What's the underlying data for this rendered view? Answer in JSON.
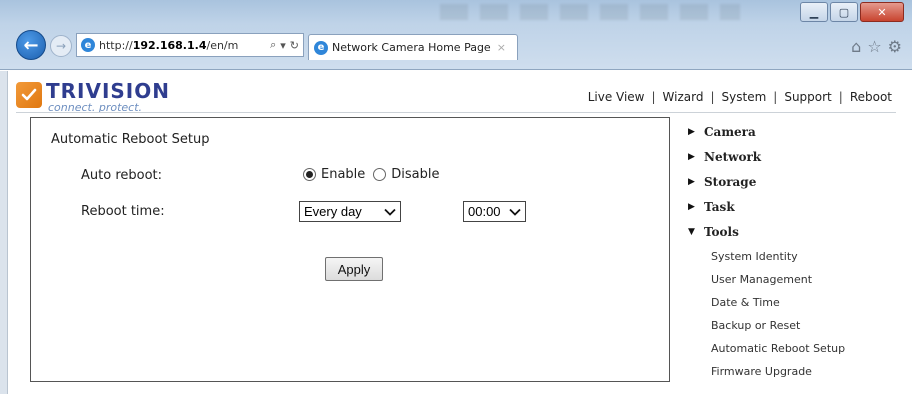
{
  "browser": {
    "url_prefix": "http://",
    "url_host": "192.168.1.4",
    "url_path": "/en/m",
    "tab_title": "Network Camera Home Page",
    "tab_close": "×",
    "back_glyph": "←",
    "forward_glyph": "→",
    "min_glyph": "▁",
    "max_glyph": "▢",
    "close_glyph": "✕",
    "search_glyph": "⌕",
    "dropdown_glyph": "▾",
    "refresh_glyph": "↻",
    "home_glyph": "⌂",
    "favorites_glyph": "☆",
    "settings_glyph": "⚙"
  },
  "brand": {
    "name": "TRIVISION",
    "tagline": "connect. protect.",
    "primary_color": "#2f3d8f",
    "accent_color": "#f29a3a"
  },
  "topnav": {
    "items": [
      "Live View",
      "Wizard",
      "System",
      "Support",
      "Reboot"
    ],
    "separator": "|"
  },
  "panel": {
    "title": "Automatic Reboot Setup",
    "auto_reboot_label": "Auto reboot:",
    "enable_label": "Enable",
    "disable_label": "Disable",
    "selected": "Enable",
    "reboot_time_label": "Reboot time:",
    "frequency_value": "Every day",
    "time_value": "00:00",
    "apply_label": "Apply"
  },
  "sidebar": {
    "sections": [
      {
        "label": "Camera",
        "expanded": false
      },
      {
        "label": "Network",
        "expanded": false
      },
      {
        "label": "Storage",
        "expanded": false
      },
      {
        "label": "Task",
        "expanded": false
      },
      {
        "label": "Tools",
        "expanded": true
      }
    ],
    "tools_items": [
      "System Identity",
      "User Management",
      "Date & Time",
      "Backup or Reset",
      "Automatic Reboot Setup",
      "Firmware Upgrade"
    ],
    "collapsed_glyph": "▶",
    "expanded_glyph": "▼"
  }
}
